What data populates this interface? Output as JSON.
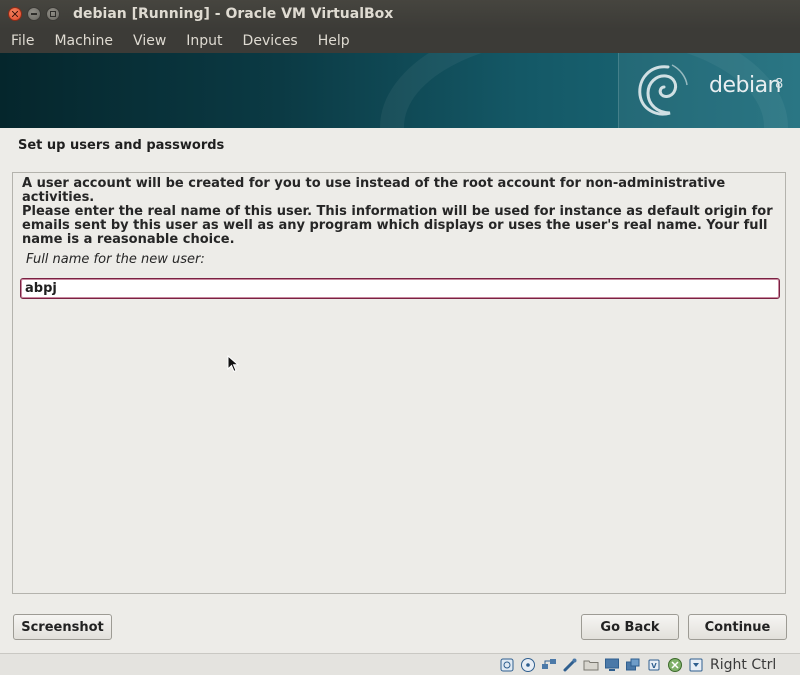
{
  "window": {
    "title": "debian [Running] - Oracle VM VirtualBox"
  },
  "menubar": {
    "items": [
      {
        "label": "File"
      },
      {
        "label": "Machine"
      },
      {
        "label": "View"
      },
      {
        "label": "Input"
      },
      {
        "label": "Devices"
      },
      {
        "label": "Help"
      }
    ]
  },
  "banner": {
    "wordmark": "debian",
    "version": "8"
  },
  "installer": {
    "step_title": "Set up users and passwords",
    "paragraph_1": "A user account will be created for you to use instead of the root account for non-administrative activities.",
    "paragraph_2": "Please enter the real name of this user. This information will be used for instance as default origin for emails sent by this user as well as any program which displays or uses the user's real name. Your full name is a reasonable choice.",
    "field_label": "Full name for the new user:",
    "field_value": "abpj"
  },
  "buttons": {
    "screenshot": "Screenshot",
    "go_back": "Go Back",
    "continue": "Continue"
  },
  "statusbar": {
    "icons": [
      "hard-disk-icon",
      "optical-disk-icon",
      "network-icon",
      "usb-icon",
      "shared-folders-icon",
      "display-icon",
      "video-capture-icon",
      "cpu-icon",
      "mouse-integration-icon",
      "keyboard-capture-icon"
    ],
    "host_key": "Right Ctrl"
  },
  "colors": {
    "titlebar": "#3c3b37",
    "banner_dark": "#05262c",
    "banner_light": "#1d6e7d",
    "input_border": "#7a2142",
    "close_button": "#e0472a"
  }
}
